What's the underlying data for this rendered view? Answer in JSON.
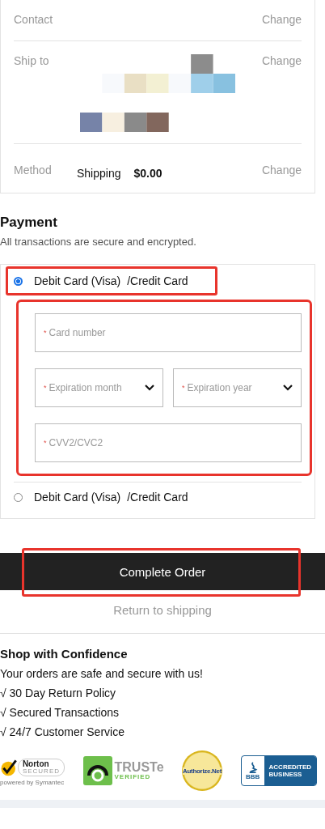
{
  "summary": {
    "rows": [
      {
        "label": "Contact",
        "action": "Change"
      },
      {
        "label": "Ship to",
        "kind": "picture",
        "action": "Change"
      },
      {
        "label": "Method",
        "value": "Shipping",
        "price": "$0.00",
        "action": "Change"
      }
    ]
  },
  "payment": {
    "title": "Payment",
    "subtitle": "All transactions are secure and encrypted.",
    "options": [
      {
        "label": "Debit Card (Visa)",
        "suffix": "/Credit Card",
        "selected": true,
        "highlighted": true
      },
      {
        "label": "Debit Card (Visa)",
        "suffix": "/Credit Card",
        "selected": false,
        "highlighted": false
      }
    ],
    "fields": [
      {
        "kind": "input",
        "placeholder": "Card number"
      },
      {
        "kind": "select",
        "placeholder": "Expiration month"
      },
      {
        "kind": "select",
        "placeholder": "Expiration year"
      },
      {
        "kind": "input",
        "placeholder": "CVV2/CVC2"
      }
    ],
    "required_mark": "*",
    "fields_highlighted": true
  },
  "complete_button": {
    "label": "Complete Order",
    "highlighted": true
  },
  "return_link": "Return to shipping",
  "confidence": {
    "title": "Shop with Confidence",
    "intro": "Your orders are safe and secure with us!",
    "items": [
      "√ 30 Day Return Policy",
      "√ Secured Transactions",
      "√ 24/7 Customer Service"
    ]
  },
  "badges": [
    {
      "kind": "norton",
      "texts": [
        "Norton",
        "SECURED",
        "powered by Symantec"
      ]
    },
    {
      "kind": "truste",
      "texts": [
        "TRUSTe",
        "VERIFIED"
      ]
    },
    {
      "kind": "authorize",
      "texts": [
        "Authorize.Net"
      ]
    },
    {
      "kind": "bbb",
      "texts": [
        "BBB",
        "ACCREDITED",
        "BUSINESS"
      ]
    }
  ]
}
